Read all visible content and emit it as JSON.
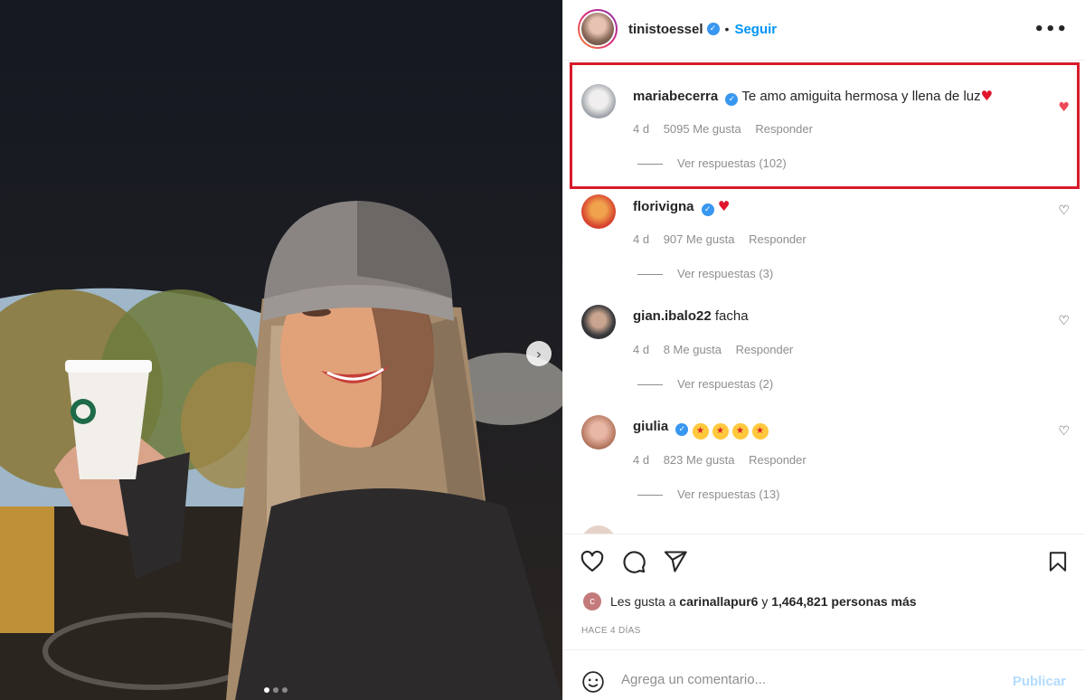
{
  "photo": {
    "alt_description": "",
    "dots": [
      true,
      false,
      false
    ],
    "next_icon": "chevron-right-icon"
  },
  "header": {
    "username": "tinistoessel",
    "follow_label": "Seguir",
    "separator": "•",
    "more_icon": "•••"
  },
  "comments": [
    {
      "username": "mariabecerra",
      "verified": true,
      "text": "Te amo amiguita hermosa y llena de luz",
      "emoji": "♥",
      "time": "4 d",
      "likes": "5095 Me gusta",
      "reply": "Responder",
      "view_replies": "Ver respuestas (102)",
      "liked": true
    },
    {
      "username": "florivigna",
      "verified": true,
      "text": "",
      "emoji": "♥",
      "time": "4 d",
      "likes": "907 Me gusta",
      "reply": "Responder",
      "view_replies": "Ver respuestas (3)",
      "liked": false
    },
    {
      "username": "gian.ibalo22",
      "verified": false,
      "text": "facha",
      "time": "4 d",
      "likes": "8 Me gusta",
      "reply": "Responder",
      "view_replies": "Ver respuestas (2)",
      "liked": false
    },
    {
      "username": "giulia",
      "verified": true,
      "text": "",
      "emoji": "★",
      "time": "4 d",
      "likes": "823 Me gusta",
      "reply": "Responder",
      "view_replies": "Ver respuestas (13)",
      "liked": false
    }
  ],
  "likes_line": {
    "prefix": "Les gusta a",
    "user": "carinallapur6",
    "joiner": "y",
    "count": "1,464,821 personas más",
    "avatar_letter": "c"
  },
  "date": "HACE 4 DÍAS",
  "add_comment": {
    "placeholder": "Agrega un comentario...",
    "publish_label": "Publicar"
  },
  "colors": {
    "accent": "#0095f6",
    "highlight": "#d71a2b",
    "like_red": "#ed4956"
  }
}
